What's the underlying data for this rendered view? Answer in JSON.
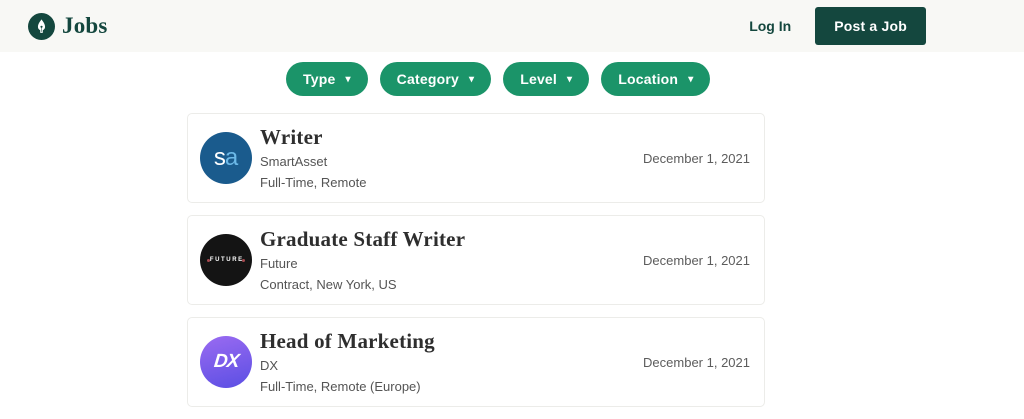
{
  "header": {
    "brand": "Jobs",
    "login_label": "Log In",
    "post_job_label": "Post a Job"
  },
  "icons": {
    "caret_down": "▾",
    "brand_icon": "pen-nib"
  },
  "filters": [
    {
      "label": "Type"
    },
    {
      "label": "Category"
    },
    {
      "label": "Level"
    },
    {
      "label": "Location"
    }
  ],
  "jobs": [
    {
      "logo": [
        "s",
        "a"
      ],
      "title": "Writer",
      "company": "SmartAsset",
      "meta": "Full-Time, Remote",
      "date": "December 1, 2021"
    },
    {
      "logo": [
        "FUTURE"
      ],
      "title": "Graduate Staff Writer",
      "company": "Future",
      "meta": "Contract, New York, US",
      "date": "December 1, 2021"
    },
    {
      "logo": [
        "DX"
      ],
      "title": "Head of Marketing",
      "company": "DX",
      "meta": "Full-Time, Remote (Europe)",
      "date": "December 1, 2021"
    }
  ],
  "colors": {
    "header_bg": "#F8F8F5",
    "dark_green": "#14473E",
    "accent_green": "#1B9469",
    "sa_blue": "#1A5B8D",
    "sa_light_blue": "#6CB9E8",
    "future_black": "#141414",
    "dx_purple": "#9468F0",
    "dx_blue": "#5E50E4",
    "title_text": "#2E2E2E",
    "muted_text": "#545454"
  }
}
